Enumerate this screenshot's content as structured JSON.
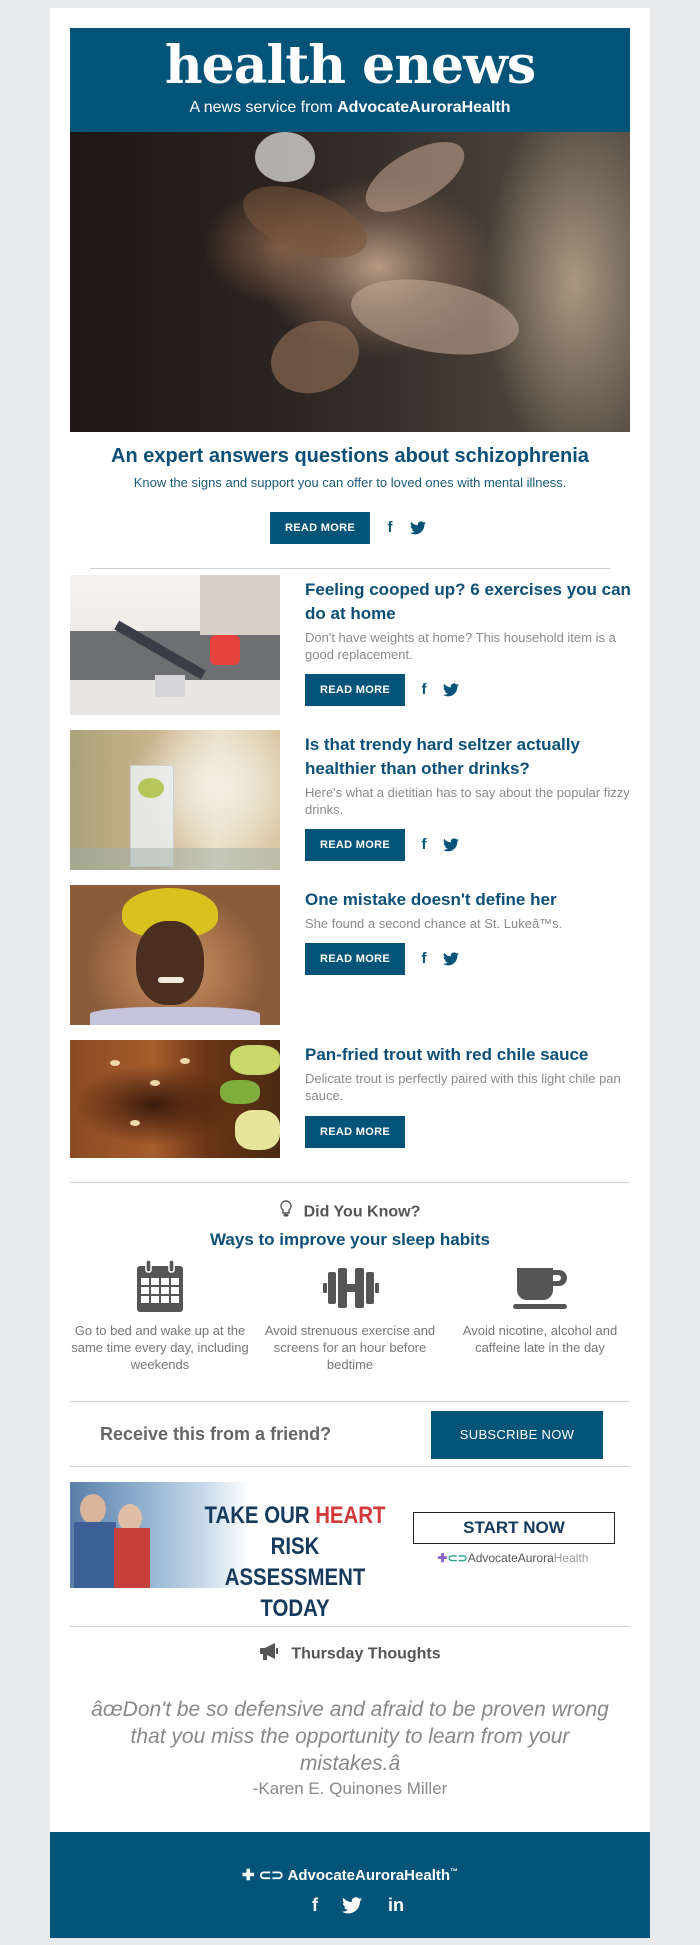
{
  "header": {
    "title": "health enews",
    "subtitle_prefix": "A news service from ",
    "subtitle_brand": "AdvocateAuroraHealth",
    "brand_color": "#04547a"
  },
  "hero": {
    "image_alt": "hands stacked together",
    "title": "An expert answers questions about schizophrenia",
    "description": "Know the signs and support you can offer to loved ones with mental illness.",
    "read_more": "READ MORE",
    "facebook_icon": "f",
    "twitter_icon": "twitter-bird"
  },
  "articles": [
    {
      "image_alt": "woman exercising on living room floor",
      "title": "Feeling cooped up? 6 exercises you can do at home",
      "description": "Don't have weights at home? This household item is a good replacement.",
      "read_more": "READ MORE",
      "has_social": true
    },
    {
      "image_alt": "glass of sparkling water with lime and straw",
      "title": "Is that trendy hard seltzer actually healthier than other drinks?",
      "description": "Here's what a dietitian has to say about the popular fizzy drinks.",
      "read_more": "READ MORE",
      "has_social": true
    },
    {
      "image_alt": "smiling woman in yellow headscarf",
      "title": "One mistake doesn't define her",
      "description": "She found a second chance at St. Lukeâ™s.",
      "read_more": "READ MORE",
      "has_social": true
    },
    {
      "image_alt": "pan-fried trout with pine nuts and squash",
      "title": "Pan-fried trout with red chile sauce",
      "description": "Delicate trout is perfectly paired with this light chile pan sauce.",
      "read_more": "READ MORE",
      "has_social": false
    }
  ],
  "did_you_know": {
    "heading": "Did You Know?",
    "subheading": "Ways to improve your sleep habits",
    "tips": [
      {
        "icon": "calendar-icon",
        "text": "Go to bed and wake up at the same time every day, including weekends"
      },
      {
        "icon": "dumbbell-icon",
        "text": "Avoid strenuous exercise and screens for an hour before bedtime"
      },
      {
        "icon": "coffee-cup-icon",
        "text": "Avoid nicotine, alcohol and caffeine late in the day"
      }
    ]
  },
  "subscribe": {
    "prompt": "Receive this from a friend?",
    "button": "SUBSCRIBE NOW"
  },
  "ad": {
    "line1_a": "TAKE OUR ",
    "line1_b": "HEART",
    "line1_c": " RISK",
    "line2": "ASSESSMENT TODAY",
    "cta": "START NOW",
    "brand_a": "AdvocateAurora",
    "brand_b": "Health",
    "accent_red": "#d23a3a",
    "text_navy": "#163a5c"
  },
  "thoughts": {
    "heading": "Thursday Thoughts",
    "quote": "âœDon't be so defensive and afraid to be proven wrong that you miss the opportunity to learn from your mistakes.â",
    "author": "-Karen E. Quinones Miller"
  },
  "footer": {
    "brand": "AdvocateAuroraHealth",
    "tm": "™",
    "facebook": "f",
    "linkedin": "in"
  }
}
